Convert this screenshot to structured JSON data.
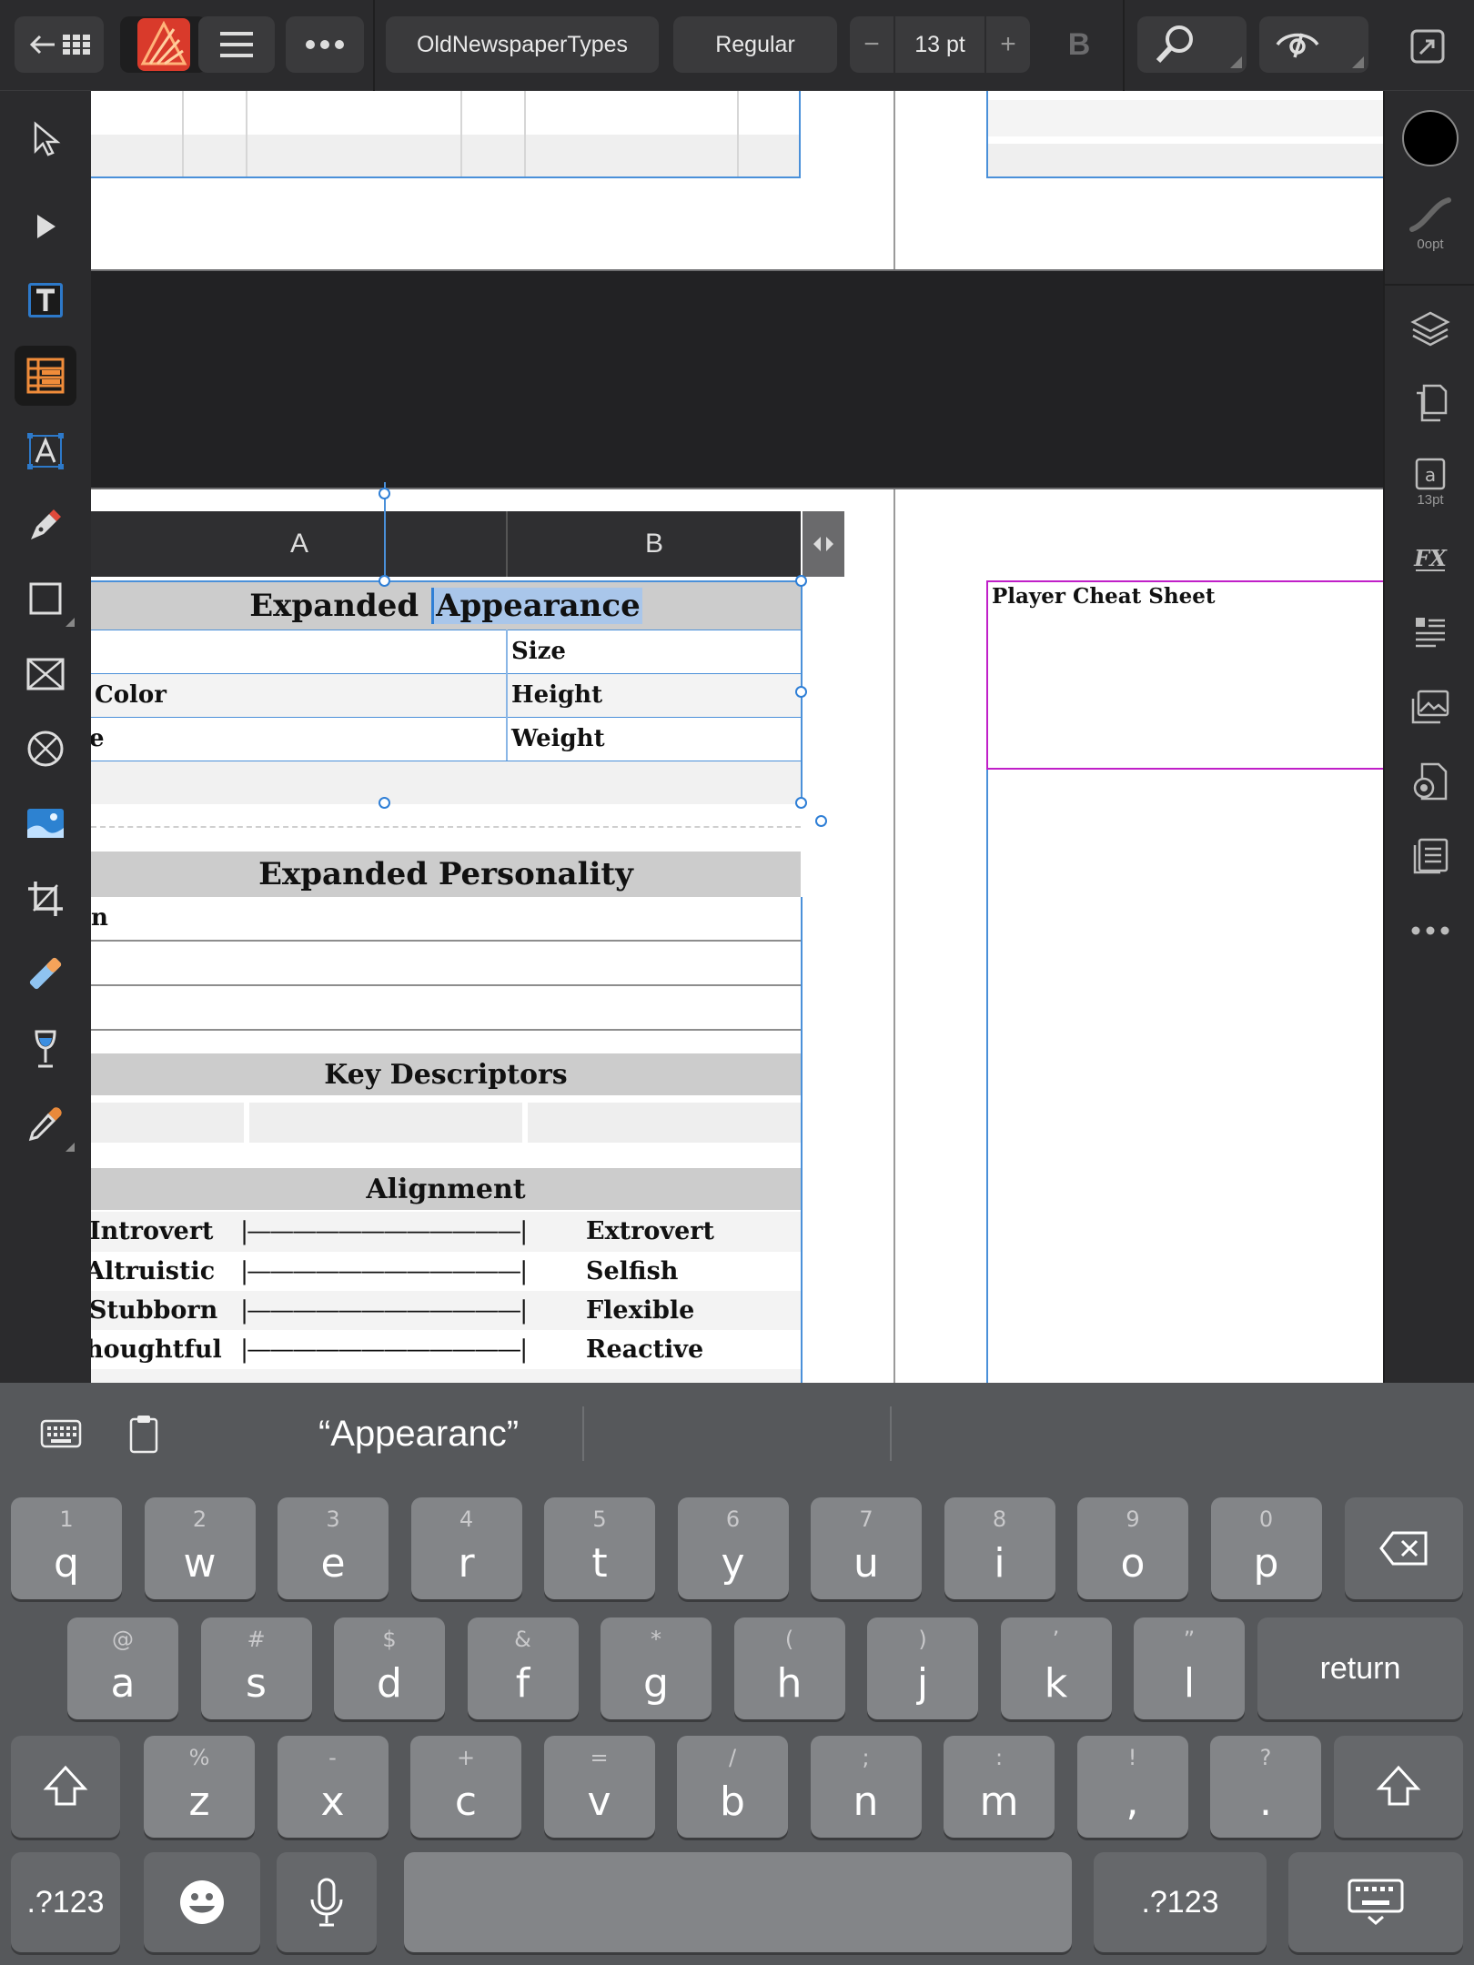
{
  "toolbar": {
    "font_family": "OldNewspaperTypes",
    "font_style": "Regular",
    "font_size": "13 pt",
    "decrease": "−",
    "increase": "+",
    "bold": "B"
  },
  "right_panel": {
    "stroke_width": "0opt",
    "text_style_size": "13pt"
  },
  "canvas": {
    "columns": [
      "A",
      "B"
    ],
    "appearance": {
      "title_prefix": "Expanded",
      "title_selected": "Appearance",
      "rows": [
        [
          "",
          "Size"
        ],
        [
          "Color",
          "Height"
        ],
        [
          "e",
          "Weight"
        ]
      ]
    },
    "personality": {
      "title": "Expanded Personality",
      "first_row": "n"
    },
    "descriptors_title": "Key Descriptors",
    "alignment": {
      "title": "Alignment",
      "scale": "|————————————|",
      "rows": [
        [
          "Introvert",
          "Extrovert"
        ],
        [
          "Altruistic",
          "Selfish"
        ],
        [
          "Stubborn",
          "Flexible"
        ],
        [
          "houghtful",
          "Reactive"
        ]
      ]
    },
    "cheat_sheet_title": "Player Cheat Sheet"
  },
  "keyboard": {
    "suggestion": "“Appearanc”",
    "row1": [
      {
        "k": "q",
        "s": "1"
      },
      {
        "k": "w",
        "s": "2"
      },
      {
        "k": "e",
        "s": "3"
      },
      {
        "k": "r",
        "s": "4"
      },
      {
        "k": "t",
        "s": "5"
      },
      {
        "k": "y",
        "s": "6"
      },
      {
        "k": "u",
        "s": "7"
      },
      {
        "k": "i",
        "s": "8"
      },
      {
        "k": "o",
        "s": "9"
      },
      {
        "k": "p",
        "s": "0"
      }
    ],
    "row2": [
      {
        "k": "a",
        "s": "@"
      },
      {
        "k": "s",
        "s": "#"
      },
      {
        "k": "d",
        "s": "$"
      },
      {
        "k": "f",
        "s": "&"
      },
      {
        "k": "g",
        "s": "*"
      },
      {
        "k": "h",
        "s": "("
      },
      {
        "k": "j",
        "s": ")"
      },
      {
        "k": "k",
        "s": "’"
      },
      {
        "k": "l",
        "s": "”"
      }
    ],
    "row3": [
      {
        "k": "z",
        "s": "%"
      },
      {
        "k": "x",
        "s": "-"
      },
      {
        "k": "c",
        "s": "+"
      },
      {
        "k": "v",
        "s": "="
      },
      {
        "k": "b",
        "s": "/"
      },
      {
        "k": "n",
        "s": ";"
      },
      {
        "k": "m",
        "s": ":"
      },
      {
        "k": ",",
        "s": "!"
      },
      {
        "k": ".",
        "s": "?"
      }
    ],
    "return_label": "return",
    "numbers_label": ".?123"
  }
}
